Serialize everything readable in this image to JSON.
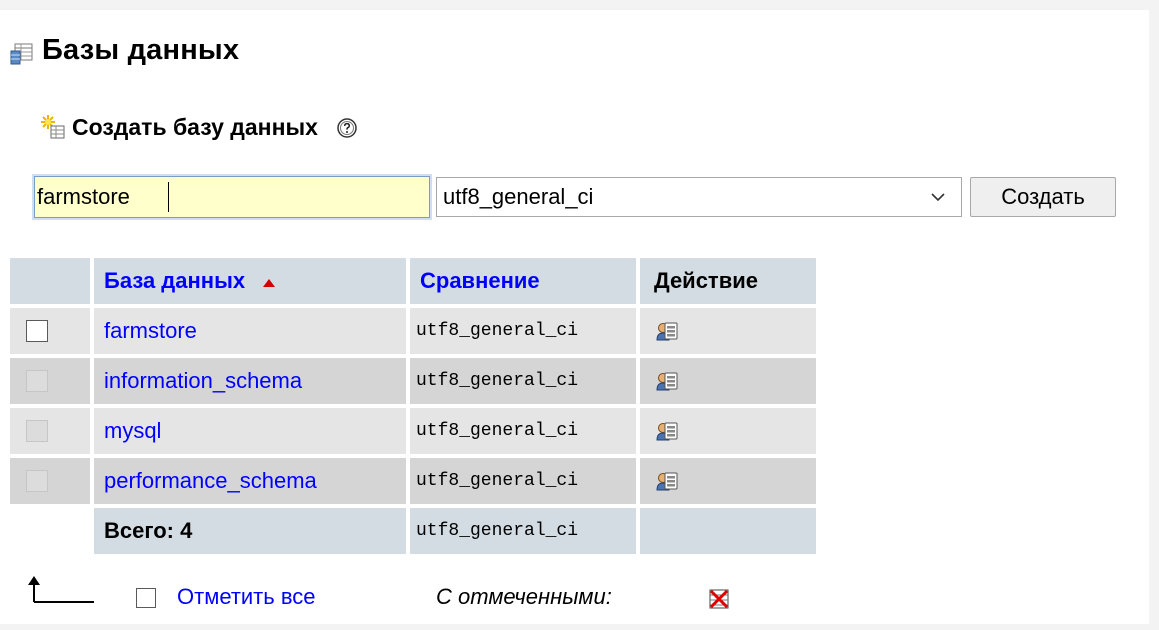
{
  "heading": {
    "title": "Базы данных",
    "icon": "database-list-icon"
  },
  "create": {
    "label": "Создать базу данных",
    "icon": "create-database-icon",
    "help_icon": "help-icon",
    "db_name_value": "farmstore",
    "collation_value": "utf8_general_ci",
    "submit_label": "Создать"
  },
  "table": {
    "headers": {
      "database": "База данных",
      "collation": "Сравнение",
      "action": "Действие"
    },
    "rows": [
      {
        "name": "farmstore",
        "collation": "utf8_general_ci",
        "checkbox_enabled": true
      },
      {
        "name": "information_schema",
        "collation": "utf8_general_ci",
        "checkbox_enabled": false
      },
      {
        "name": "mysql",
        "collation": "utf8_general_ci",
        "checkbox_enabled": false
      },
      {
        "name": "performance_schema",
        "collation": "utf8_general_ci",
        "checkbox_enabled": false
      }
    ],
    "total": {
      "label": "Всего: 4",
      "collation": "utf8_general_ci"
    }
  },
  "footer": {
    "check_all_label": "Отметить все",
    "with_selected_label": "С отмеченными:"
  },
  "colors": {
    "link": "#0000ff",
    "header_bg": "#d3dce3",
    "input_bg": "#ffffcc",
    "sort_arrow": "#d40000"
  }
}
